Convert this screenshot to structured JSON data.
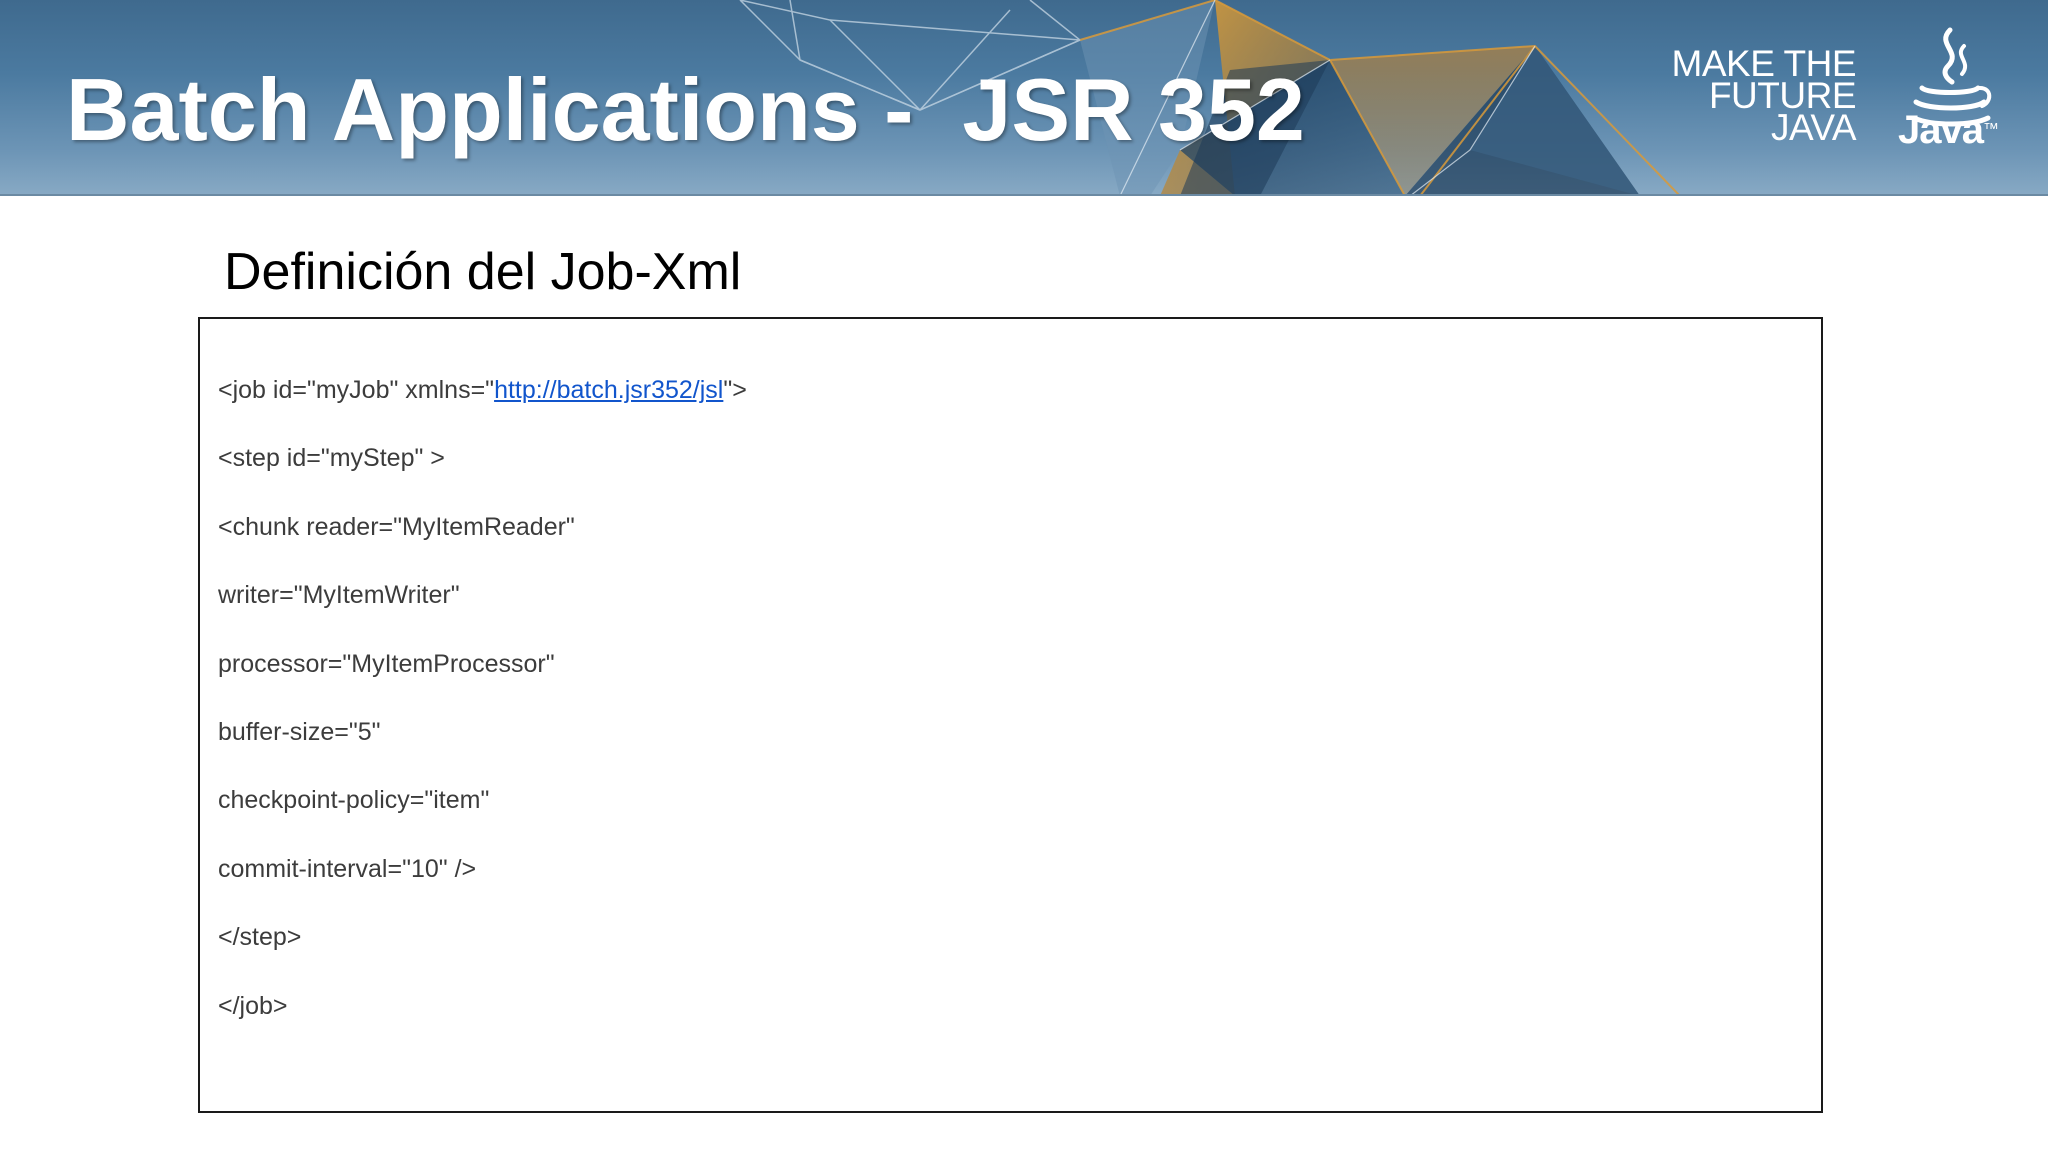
{
  "banner": {
    "title": "Batch Applications -  JSR 352",
    "tagline": [
      "MAKE THE",
      "FUTURE",
      "JAVA"
    ],
    "logo_icon": "java-cup-icon",
    "logo_text": "Java",
    "logo_tm": "™",
    "colors": {
      "background": "#4b7aa0",
      "accent_orange": "#c8902e"
    }
  },
  "slide": {
    "subtitle": "Definición del Job-Xml"
  },
  "code": {
    "line1_prefix": "<job id=\"myJob\" xmlns=\"",
    "line1_link": "http://batch.jsr352/jsl",
    "line1_suffix": "\">",
    "lines": [
      "<step id=\"myStep\" >",
      "<chunk reader=\"MyItemReader\"",
      "writer=\"MyItemWriter\"",
      "processor=\"MyItemProcessor\"",
      "buffer-size=\"5\"",
      "checkpoint-policy=\"item\"",
      "commit-interval=\"10\" />",
      "</step>",
      "</job>"
    ],
    "link_color": "#1155cc"
  }
}
